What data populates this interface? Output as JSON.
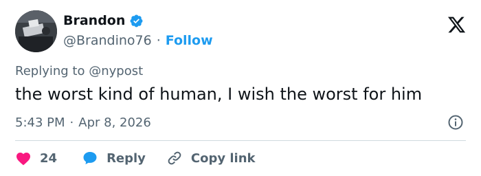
{
  "colors": {
    "verified_blue": "#1d9bf0",
    "like_red": "#f91880",
    "reply_blue": "#1d9bf0",
    "muted_gray": "#536471",
    "text_black": "#0f1419"
  },
  "author": {
    "name": "Brandon",
    "handle": "@Brandino76",
    "separator": "·",
    "follow_label": "Follow",
    "verified_icon": "verified-badge-icon"
  },
  "tweet": {
    "replying_prefix": "Replying to",
    "replying_mention": "@nypost",
    "text": "the worst kind of human, I wish the worst for him",
    "time": "5:43 PM",
    "time_separator": "·",
    "date": "Apr 8, 2026"
  },
  "actions": {
    "like_count": "24",
    "reply_label": "Reply",
    "copy_link_label": "Copy link"
  },
  "icons": {
    "logo": "x-logo-icon",
    "info": "info-icon",
    "like": "heart-icon",
    "reply": "speech-bubble-icon",
    "copy": "link-icon"
  }
}
